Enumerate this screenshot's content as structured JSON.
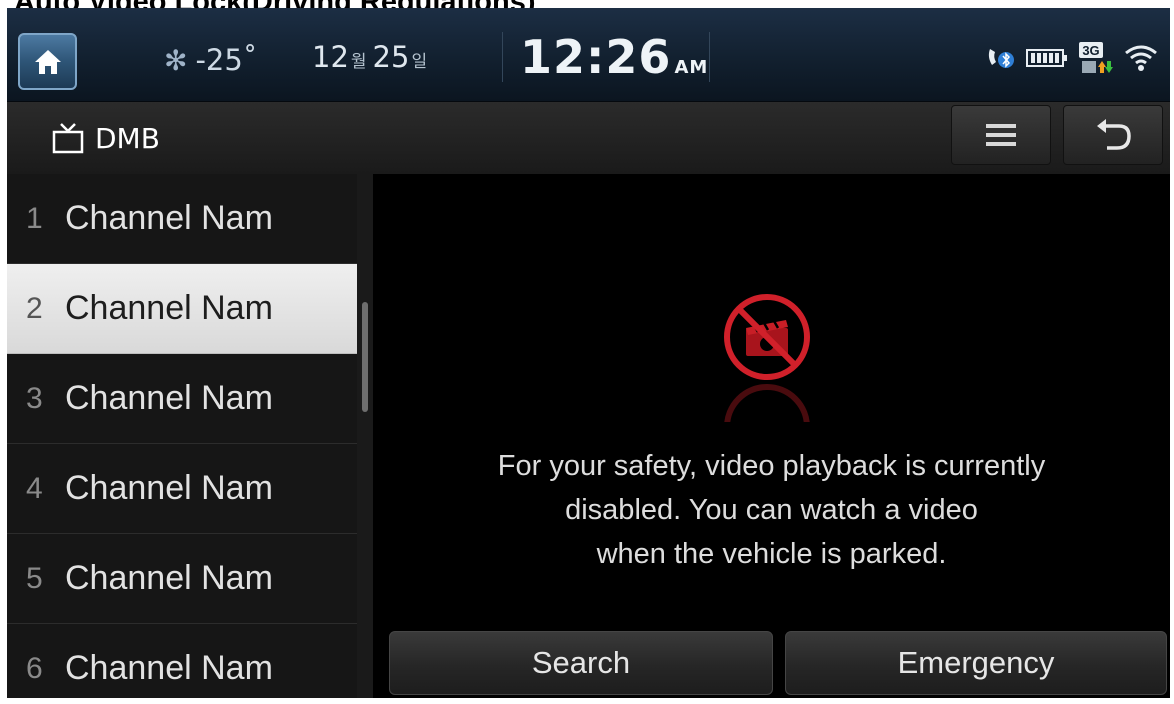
{
  "caption": "Auto Video Lock(Driving Regulations)",
  "status_bar": {
    "temperature": "-25˚",
    "month": "12",
    "month_unit": "월",
    "day": "25",
    "day_unit": "일",
    "time": "12:26",
    "ampm": "AM",
    "network": "3G",
    "icons": [
      "home-icon",
      "snowflake-icon",
      "bluetooth-phone-icon",
      "battery-icon",
      "network-3g-icon",
      "wifi-icon"
    ]
  },
  "header": {
    "title": "DMB",
    "icons": [
      "tv-icon",
      "menu-icon",
      "back-icon"
    ]
  },
  "channels": [
    {
      "number": "1",
      "name": "Channel Nam"
    },
    {
      "number": "2",
      "name": "Channel Nam"
    },
    {
      "number": "3",
      "name": "Channel Nam"
    },
    {
      "number": "4",
      "name": "Channel Nam"
    },
    {
      "number": "5",
      "name": "Channel Nam"
    },
    {
      "number": "6",
      "name": "Channel Nam"
    }
  ],
  "selected_channel": "2",
  "video_lock": {
    "icon": "no-video-icon",
    "message_lines": [
      "For your safety, video playback is currently",
      "disabled. You can watch a video",
      "when the vehicle is parked."
    ]
  },
  "buttons": {
    "search": "Search",
    "emergency": "Emergency"
  },
  "colors": {
    "status_bar": "#12202f",
    "home_button": "#2e5577",
    "lock_icon_red": "#d0202a",
    "selected_row": "#e6e6e6"
  }
}
